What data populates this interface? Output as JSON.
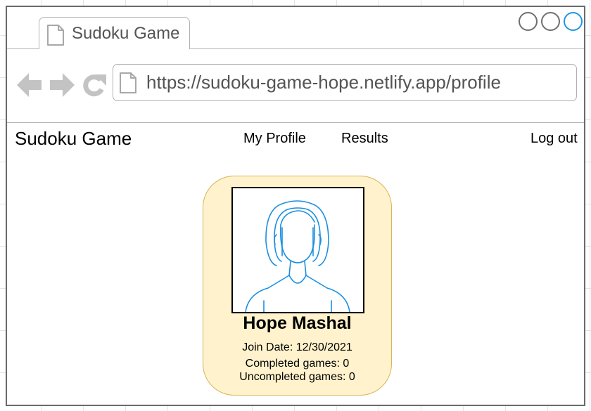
{
  "browser": {
    "tab_title": "Sudoku Game",
    "url": "https://sudoku-game-hope.netlify.app/profile",
    "accent_color": "#1f96e6"
  },
  "navbar": {
    "brand": "Sudoku Game",
    "links": {
      "profile": "My Profile",
      "results": "Results",
      "logout": "Log out"
    }
  },
  "profile": {
    "name": "Hope Mashal",
    "join_date": "Join Date: 12/30/2021",
    "completed_games": "Completed games: 0",
    "uncompleted_games": "Uncompleted games: 0",
    "card_color": "#fff2cc",
    "card_border_color": "#d6b656",
    "avatar_icon": "female-user-avatar-icon"
  }
}
